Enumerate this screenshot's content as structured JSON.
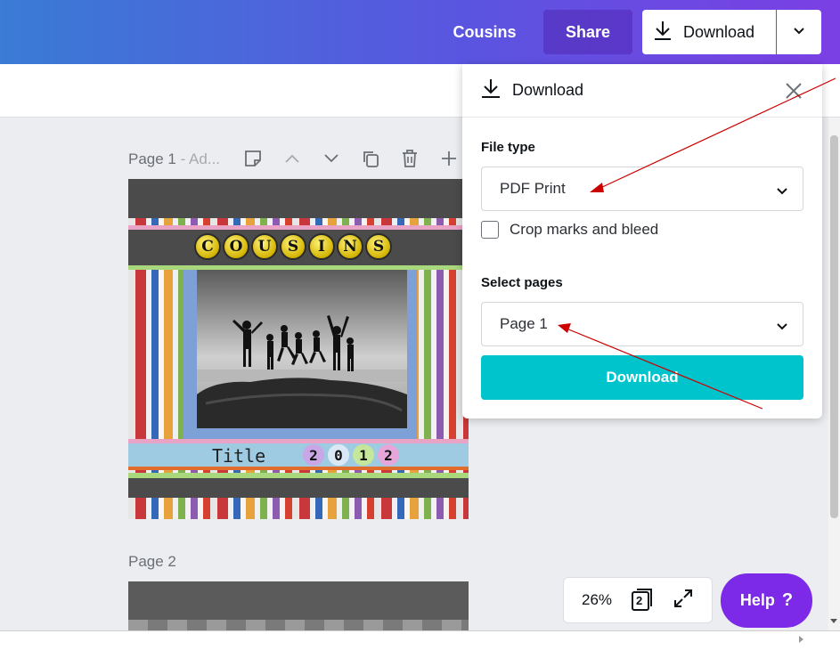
{
  "header": {
    "design_name": "Cousins",
    "share_label": "Share",
    "download_label": "Download",
    "icons": [
      "download-icon",
      "chevron-down-icon"
    ]
  },
  "canvas": {
    "page1_label": "Page 1",
    "page1_title_hint": " - Ad...",
    "page2_label": "Page 2",
    "page_tool_icons": [
      "note-icon",
      "chevron-up-icon",
      "chevron-down-icon",
      "duplicate-icon",
      "trash-icon",
      "plus-icon"
    ],
    "design": {
      "banner_letters": [
        "C",
        "O",
        "U",
        "S",
        "I",
        "N",
        "S"
      ],
      "title_text": "Title",
      "year_digits": [
        "2",
        "0",
        "1",
        "2"
      ]
    }
  },
  "zoom": {
    "value": "26%",
    "page_count": "2",
    "icons": [
      "pages-icon",
      "fullscreen-icon"
    ]
  },
  "help": {
    "label": "Help",
    "icon": "?"
  },
  "download_panel": {
    "title": "Download",
    "file_type_label": "File type",
    "file_type_value": "PDF Print",
    "crop_marks_label": "Crop marks and bleed",
    "crop_marks_checked": false,
    "select_pages_label": "Select pages",
    "select_pages_value": "Page 1",
    "download_button": "Download",
    "icons": [
      "download-icon",
      "close-icon",
      "chevron-down-icon"
    ]
  },
  "colors": {
    "accent_teal": "#00c4cc",
    "help_purple": "#7d2ae8",
    "annotation_arrow": "#cc0000"
  }
}
